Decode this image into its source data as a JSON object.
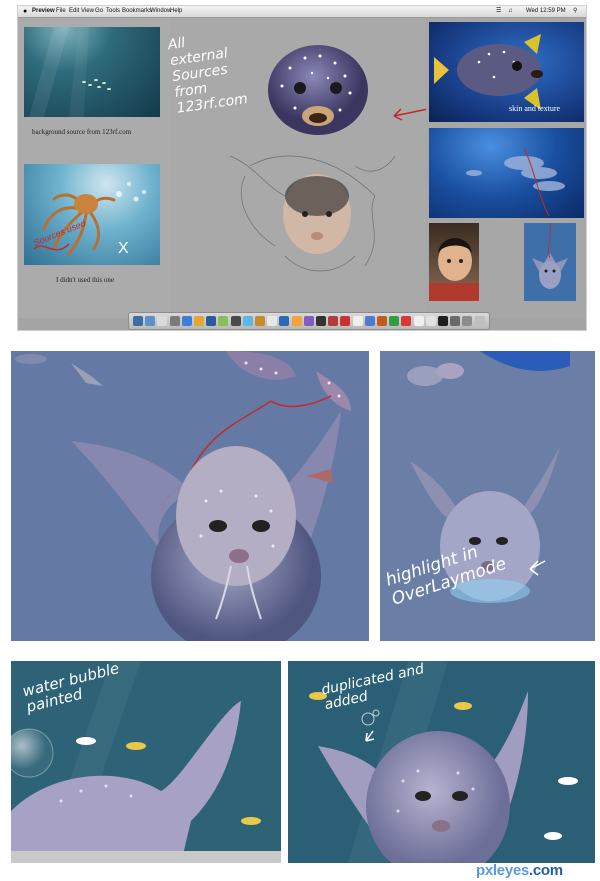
{
  "menubar": {
    "apple": "",
    "app": "Preview",
    "items": [
      "File",
      "Edit",
      "View",
      "Go",
      "Tools",
      "Bookmarks",
      "Window",
      "Help"
    ],
    "clock": "Wed 12:59 PM"
  },
  "panel1": {
    "background_caption": "background source from 123rf.com",
    "unused_caption": "I didn't used this one",
    "sources_note": "All external Sources from 123rf.com",
    "skin_caption": "skin and texture",
    "crossed_note": "Sources used",
    "cross_mark": "X"
  },
  "panel2": {
    "highlight_note": "highlight in OverLaymode"
  },
  "panel3": {
    "bubble_note": "water bubble painted",
    "duplicate_note": "duplicated and added"
  },
  "watermark": {
    "brand": "pxleyes",
    "suffix": ".com"
  },
  "colors": {
    "dock_icons": [
      "#3a6ea5",
      "#5d8fc9",
      "#d9d9d9",
      "#7a7a7a",
      "#3c7fd6",
      "#e6a531",
      "#2c5aa0",
      "#88c057",
      "#4a4a4a",
      "#5bb7e8",
      "#c98a2d",
      "#e7e7e7",
      "#2d6ab5",
      "#f2a33a",
      "#7f5fbf",
      "#333333",
      "#b23b3b",
      "#cc3030",
      "#eeeeee",
      "#4f7ccf",
      "#c45b1e",
      "#2f9e44",
      "#d93838",
      "#f0f0f0",
      "#e0e0e0",
      "#1f1f1f",
      "#6b6b6b",
      "#8c8c8c",
      "#bfbfbf"
    ]
  }
}
